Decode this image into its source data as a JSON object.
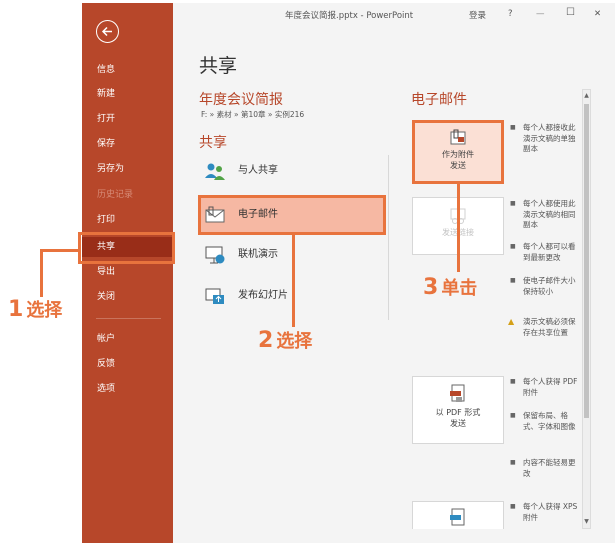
{
  "sidebar": {
    "items": [
      {
        "label": "信息"
      },
      {
        "label": "新建"
      },
      {
        "label": "打开"
      },
      {
        "label": "保存"
      },
      {
        "label": "另存为"
      },
      {
        "label": "历史记录"
      },
      {
        "label": "打印"
      },
      {
        "label": "共享"
      },
      {
        "label": "导出"
      },
      {
        "label": "关闭"
      },
      {
        "label": "帐户"
      },
      {
        "label": "反馈"
      },
      {
        "label": "选项"
      }
    ]
  },
  "titlebar": {
    "title": "年度会议简报.pptx - PowerPoint",
    "signin": "登录",
    "help": "?",
    "minimize": "—",
    "maximize": "☐",
    "close": "✕"
  },
  "main": {
    "page_title": "共享",
    "doc_title": "年度会议简报",
    "doc_path": "F: » 素材 » 第10章 » 实例216",
    "share_title": "共享",
    "share_options": [
      {
        "label": "与人共享"
      },
      {
        "label": "电子邮件"
      },
      {
        "label": "联机演示"
      },
      {
        "label": "发布幻灯片"
      }
    ]
  },
  "email": {
    "title": "电子邮件",
    "cards": [
      {
        "line1": "作为附件",
        "line2": "发送"
      },
      {
        "line1": "发送链接",
        "line2": ""
      },
      {
        "line1": "以 PDF 形式",
        "line2": "发送"
      },
      {
        "line1": "",
        "line2": ""
      }
    ],
    "descriptions": [
      {
        "text": "每个人都接收此演示文稿的单独副本"
      },
      {
        "text": "每个人都使用此演示文稿的相同副本"
      },
      {
        "text": "每个人都可以看到最新更改"
      },
      {
        "text": "使电子邮件大小保持较小"
      },
      {
        "text": "演示文稿必须保存在共享位置"
      },
      {
        "text": "每个人获得 PDF 附件"
      },
      {
        "text": "保留布局、格式、字体和图像"
      },
      {
        "text": "内容不能轻易更改"
      },
      {
        "text": "每个人获得 XPS 附件"
      }
    ]
  },
  "annotations": {
    "step1": {
      "num": "1",
      "text": "选择"
    },
    "step2": {
      "num": "2",
      "text": "选择"
    },
    "step3": {
      "num": "3",
      "text": "单击"
    }
  },
  "colors": {
    "sidebar": "#b7472a",
    "accent": "#e8733d",
    "heading": "#b7472a"
  }
}
